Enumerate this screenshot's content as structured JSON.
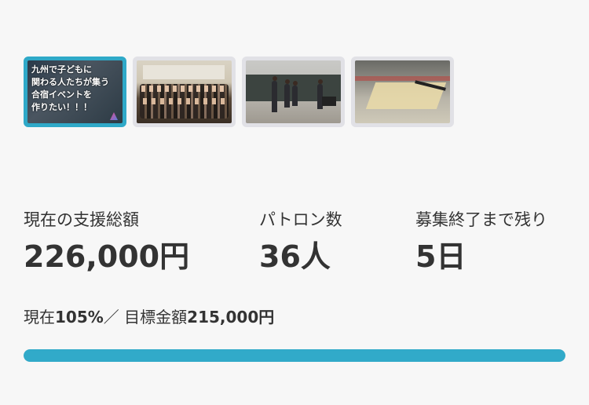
{
  "gallery": {
    "title_card_caption": "九州で子どもに\n関わる人たちが集う\n合宿イベントを\n作りたい！！！",
    "thumbnails": [
      {
        "name": "title-card"
      },
      {
        "name": "group-photo"
      },
      {
        "name": "dance-practice"
      },
      {
        "name": "paper-on-table"
      }
    ],
    "active_index": 0
  },
  "stats": {
    "total_label": "現在の支援総額",
    "total_value": "226,000円",
    "patrons_label": "パトロン数",
    "patrons_value": "36人",
    "remaining_label": "募集終了まで残り",
    "remaining_value": "5日"
  },
  "progress": {
    "current_prefix": "現在",
    "percent_text": "105%",
    "separator": "／ 目標金額",
    "goal_text": "215,000円",
    "fill_fraction": 1.0
  },
  "colors": {
    "accent": "#31aac9",
    "text": "#333333",
    "background": "#f7f7f7"
  }
}
